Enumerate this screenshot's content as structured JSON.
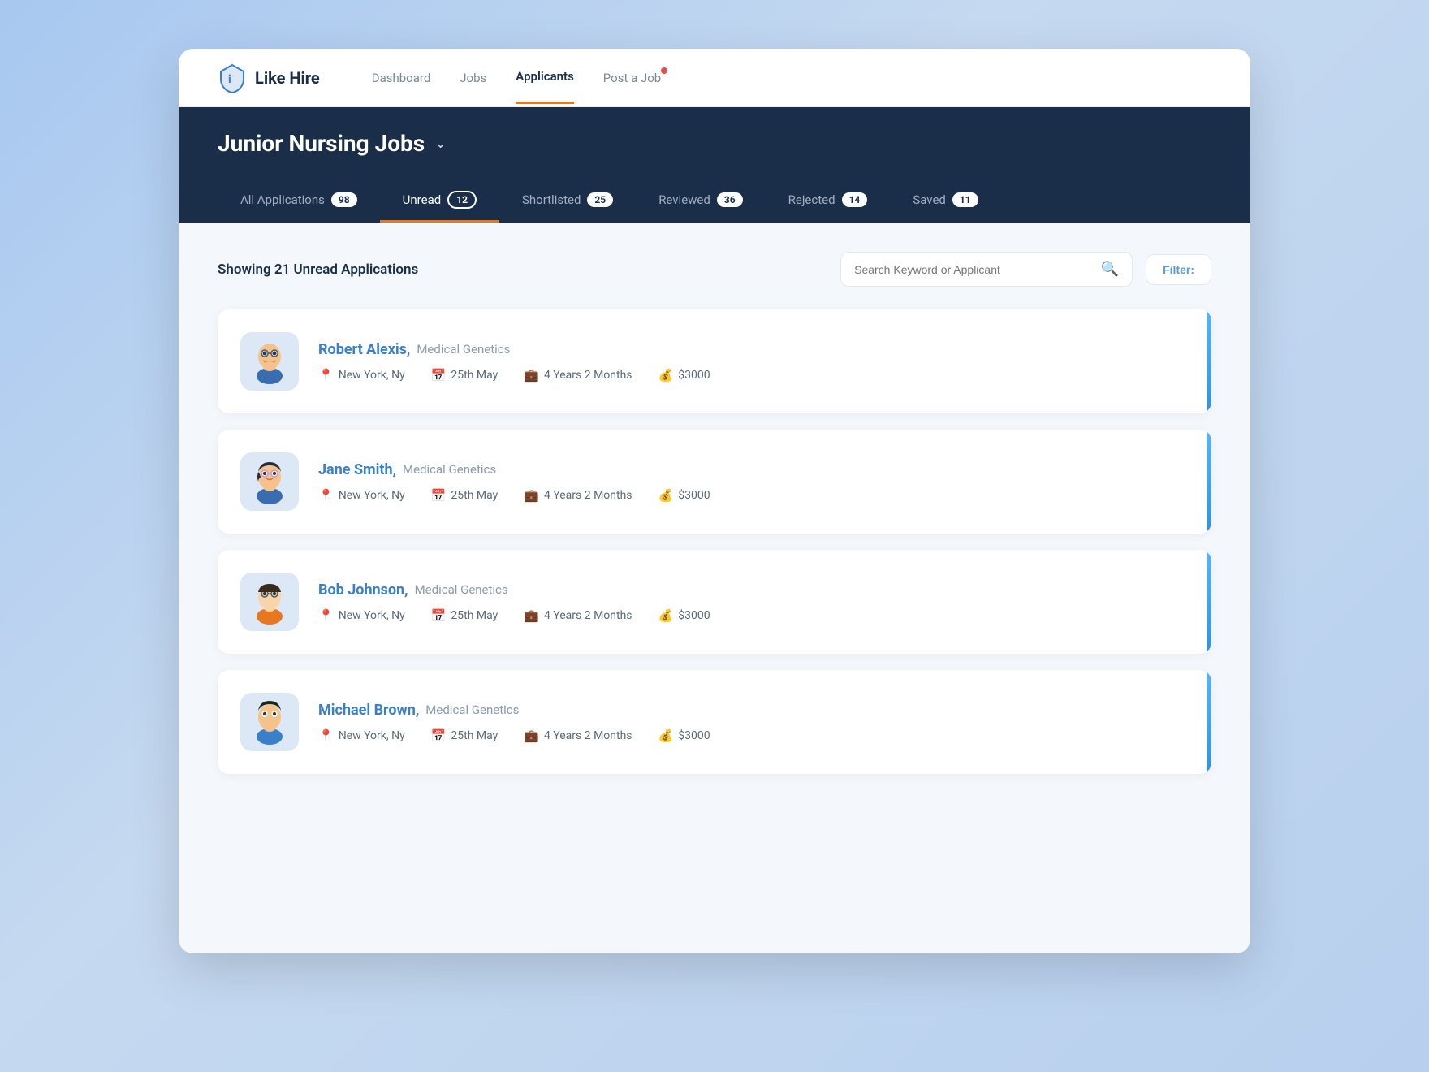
{
  "app": {
    "logo_text": "Like Hire"
  },
  "nav": {
    "links": [
      {
        "label": "Dashboard",
        "active": false
      },
      {
        "label": "Jobs",
        "active": false
      },
      {
        "label": "Applicants",
        "active": true
      },
      {
        "label": "Post a Job",
        "active": false,
        "has_dot": true
      }
    ]
  },
  "header": {
    "job_title": "Junior Nursing Jobs",
    "chevron": "∨"
  },
  "tabs": [
    {
      "label": "All Applications",
      "count": "98",
      "active": false
    },
    {
      "label": "Unread",
      "count": "12",
      "active": true
    },
    {
      "label": "Shortlisted",
      "count": "25",
      "active": false
    },
    {
      "label": "Reviewed",
      "count": "36",
      "active": false
    },
    {
      "label": "Rejected",
      "count": "14",
      "active": false
    },
    {
      "label": "Saved",
      "count": "11",
      "active": false
    }
  ],
  "main": {
    "showing_text": "Showing 21 Unread Applications",
    "search_placeholder": "Search Keyword or Applicant",
    "filter_label": "Filter:",
    "applicants": [
      {
        "name": "Robert Alexis,",
        "specialty": "Medical Genetics",
        "location": "New York, Ny",
        "date": "25th May",
        "experience": "4 Years 2 Months",
        "salary": "$3000",
        "gender": "male1"
      },
      {
        "name": "Jane Smith,",
        "specialty": "Medical Genetics",
        "location": "New York, Ny",
        "date": "25th May",
        "experience": "4 Years 2 Months",
        "salary": "$3000",
        "gender": "female"
      },
      {
        "name": "Bob Johnson,",
        "specialty": "Medical Genetics",
        "location": "New York, Ny",
        "date": "25th May",
        "experience": "4 Years 2 Months",
        "salary": "$3000",
        "gender": "male2"
      },
      {
        "name": "Michael Brown,",
        "specialty": "Medical Genetics",
        "location": "New York, Ny",
        "date": "25th May",
        "experience": "4 Years 2 Months",
        "salary": "$3000",
        "gender": "male3"
      }
    ]
  }
}
